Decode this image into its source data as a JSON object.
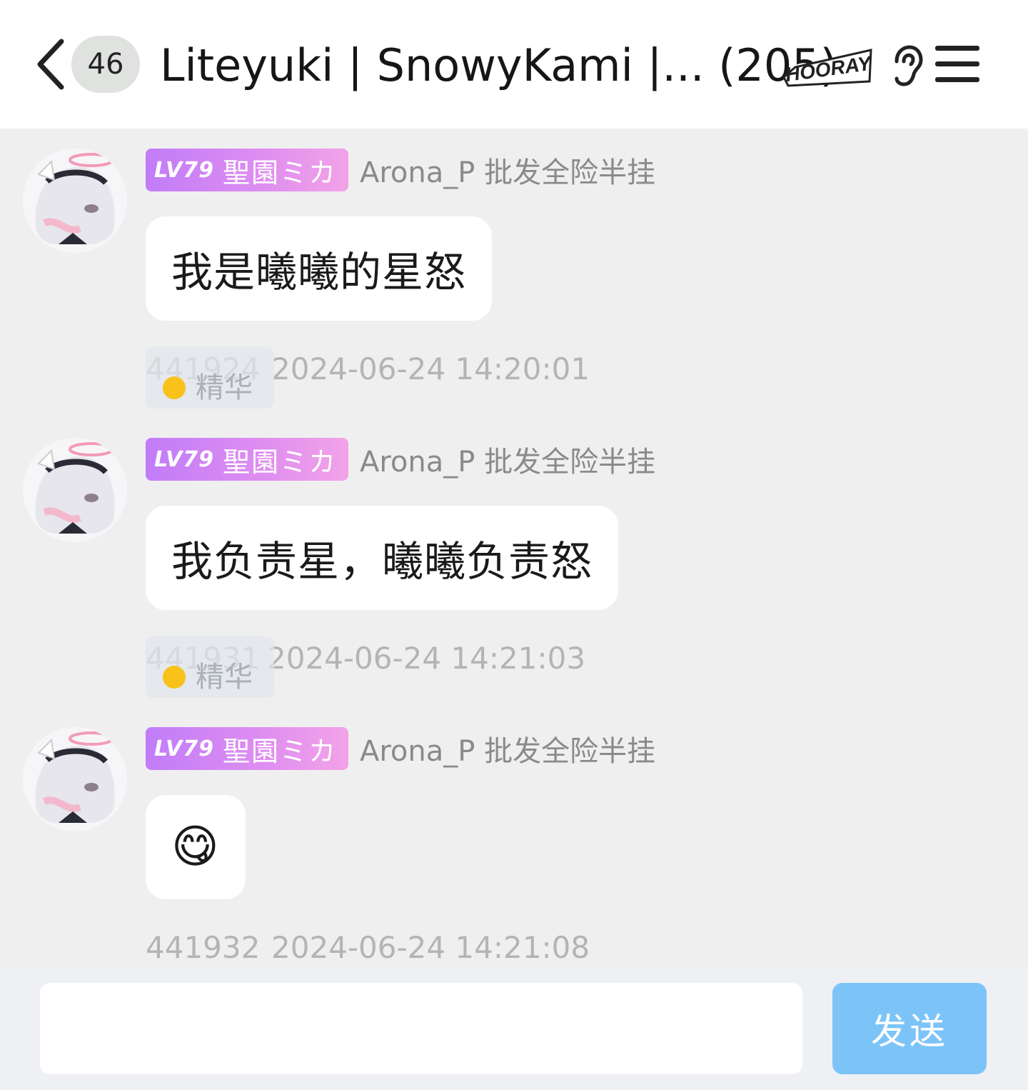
{
  "header": {
    "unread_count": "46",
    "title": "Liteyuki | SnowyKami |... (205)",
    "logo_text": "HOORAY",
    "icons": {
      "back": "chevron-left-icon",
      "ear": "ear-icon",
      "menu": "hamburger-menu-icon"
    }
  },
  "messages": [
    {
      "sender": {
        "level": "LV79",
        "title": "聖園ミカ",
        "name": "Arona_P 批发全险半挂"
      },
      "text": "我是曦曦的星怒",
      "id": "441924",
      "time": "2024-06-24 14:20:01",
      "essence_label": "精华"
    },
    {
      "sender": {
        "level": "LV79",
        "title": "聖園ミカ",
        "name": "Arona_P 批发全险半挂"
      },
      "text": "我负责星，曦曦负责怒",
      "id": "441931",
      "time": "2024-06-24 14:21:03",
      "essence_label": "精华"
    },
    {
      "sender": {
        "level": "LV79",
        "title": "聖園ミカ",
        "name": "Arona_P 批发全险半挂"
      },
      "text": "😋",
      "id": "441932",
      "time": "2024-06-24 14:21:08"
    }
  ],
  "input": {
    "value": "",
    "send_label": "发送"
  },
  "colors": {
    "accent": "#7cc4f8",
    "level_badge_start": "#c17cf8",
    "level_badge_end": "#f3a3e7",
    "background": "#efefef"
  }
}
